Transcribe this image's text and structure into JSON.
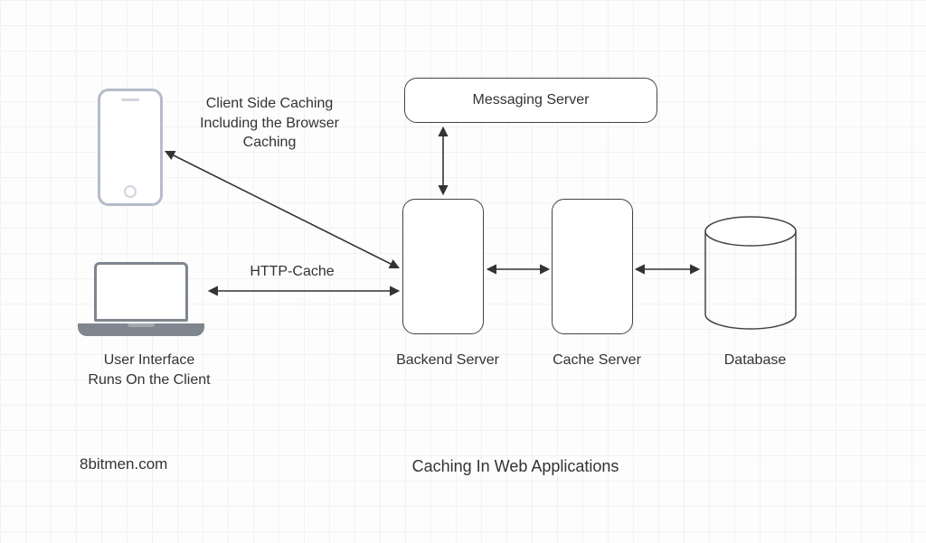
{
  "title": "Caching In Web Applications",
  "source": "8bitmen.com",
  "nodes": {
    "messaging_server": "Messaging Server",
    "backend_server": "Backend Server",
    "cache_server": "Cache Server",
    "database": "Database",
    "client_ui": "User Interface\nRuns On the Client"
  },
  "annotations": {
    "client_side_caching": "Client Side Caching\nIncluding the Browser\nCaching",
    "http_cache": "HTTP-Cache"
  }
}
